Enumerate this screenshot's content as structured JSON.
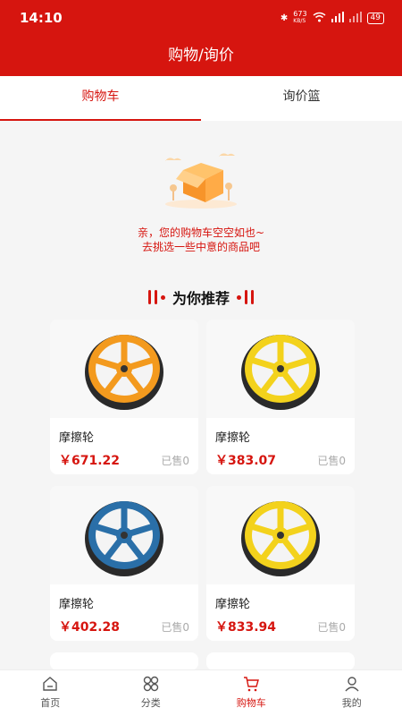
{
  "status": {
    "time": "14:10",
    "net_speed": "673",
    "net_unit": "KB/S",
    "battery": "49"
  },
  "header": {
    "title": "购物/询价"
  },
  "tabs": [
    {
      "label": "购物车"
    },
    {
      "label": "询价篮"
    }
  ],
  "empty": {
    "line1": "亲，您的购物车空空如也~",
    "line2": "去挑选一些中意的商品吧"
  },
  "recommend": {
    "title": "为你推荐"
  },
  "products": [
    {
      "name": "摩擦轮",
      "price": "￥671.22",
      "sold": "已售0",
      "color": "#f39a1e"
    },
    {
      "name": "摩擦轮",
      "price": "￥383.07",
      "sold": "已售0",
      "color": "#f3d21c"
    },
    {
      "name": "摩擦轮",
      "price": "￥402.28",
      "sold": "已售0",
      "color": "#2a6fa8"
    },
    {
      "name": "摩擦轮",
      "price": "￥833.94",
      "sold": "已售0",
      "color": "#f3d21c"
    }
  ],
  "bottom_nav": [
    {
      "label": "首页"
    },
    {
      "label": "分类"
    },
    {
      "label": "购物车"
    },
    {
      "label": "我的"
    }
  ],
  "colors": {
    "accent": "#d6150f"
  }
}
